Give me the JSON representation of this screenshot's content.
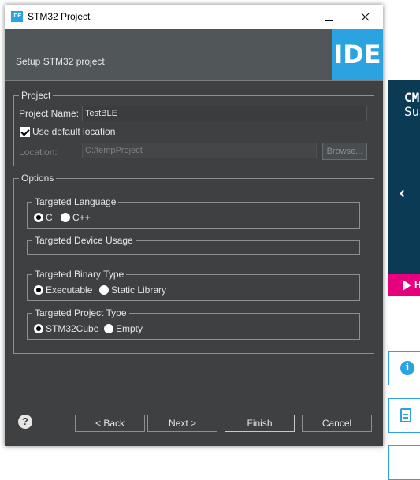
{
  "window": {
    "title": "STM32 Project",
    "app_icon": "IDE"
  },
  "banner": {
    "subtitle": "Setup STM32 project",
    "logo": "IDE",
    "logo_color": "#2ba3e0"
  },
  "project": {
    "legend": "Project",
    "name_label": "Project Name:",
    "name_value": "TestBLE",
    "default_location_label": "Use default location",
    "default_location_checked": true,
    "location_label": "Location:",
    "location_value": "C:/tempProject",
    "browse_label": "Browse..."
  },
  "options": {
    "legend": "Options",
    "language": {
      "legend": "Targeted Language",
      "options": [
        "C",
        "C++"
      ],
      "selected": "C"
    },
    "device_usage": {
      "legend": "Targeted Device Usage"
    },
    "binary": {
      "legend": "Targeted Binary Type",
      "options": [
        "Executable",
        "Static Library"
      ],
      "selected": "Executable"
    },
    "project_type": {
      "legend": "Targeted Project Type",
      "options": [
        "STM32Cube",
        "Empty"
      ],
      "selected": "STM32Cube"
    }
  },
  "footer": {
    "back": "< Back",
    "next": "Next >",
    "finish": "Finish",
    "cancel": "Cancel",
    "help": "?"
  },
  "background": {
    "line1": "CM",
    "line2": "Su",
    "arrow": "‹",
    "banner_letter": "H",
    "info_icon": "i"
  }
}
